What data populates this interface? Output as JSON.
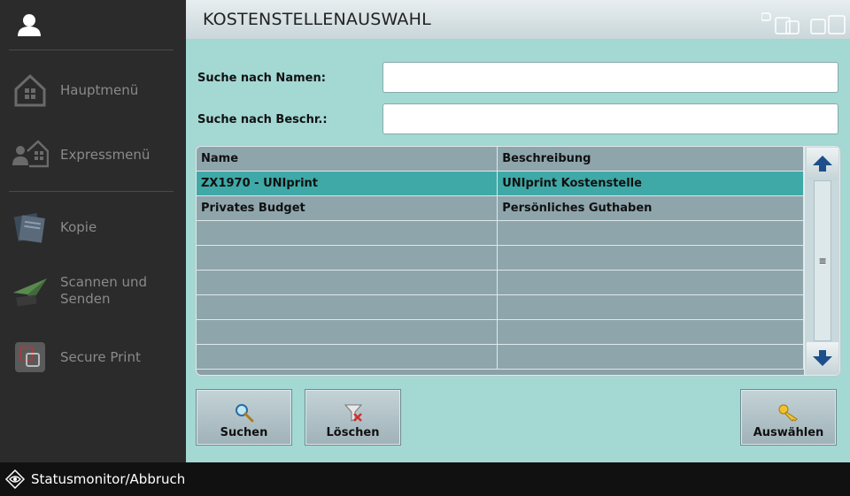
{
  "sidebar": {
    "items": [
      {
        "label": "Hauptmenü",
        "icon": "house-icon"
      },
      {
        "label": "Expressmenü",
        "icon": "user-house-icon"
      },
      {
        "label": "Kopie",
        "icon": "copy-icon"
      },
      {
        "label": "Scannen und\nSenden",
        "icon": "paper-plane-icon"
      },
      {
        "label": "Secure Print",
        "icon": "secure-print-icon"
      }
    ]
  },
  "statusbar": {
    "label": "Statusmonitor/Abbruch"
  },
  "header": {
    "title": "KOSTENSTELLENAUSWAHL"
  },
  "search": {
    "name_label": "Suche nach Namen:",
    "name_value": "",
    "desc_label": "Suche nach Beschr.:",
    "desc_value": ""
  },
  "table": {
    "columns": [
      "Name",
      "Beschreibung"
    ],
    "rows": [
      {
        "name": "ZX1970 - UNIprint",
        "desc": "UNIprint Kostenstelle",
        "selected": true
      },
      {
        "name": "Privates Budget",
        "desc": "Persönliches Guthaben",
        "selected": false
      },
      {
        "name": "",
        "desc": "",
        "selected": false
      },
      {
        "name": "",
        "desc": "",
        "selected": false
      },
      {
        "name": "",
        "desc": "",
        "selected": false
      },
      {
        "name": "",
        "desc": "",
        "selected": false
      },
      {
        "name": "",
        "desc": "",
        "selected": false
      },
      {
        "name": "",
        "desc": "",
        "selected": false
      }
    ]
  },
  "buttons": {
    "search": "Suchen",
    "clear": "Löschen",
    "select": "Auswählen"
  },
  "colors": {
    "accent": "#a3d8d3",
    "selected_row": "#3fa9a7",
    "sidebar": "#2b2b2b"
  }
}
